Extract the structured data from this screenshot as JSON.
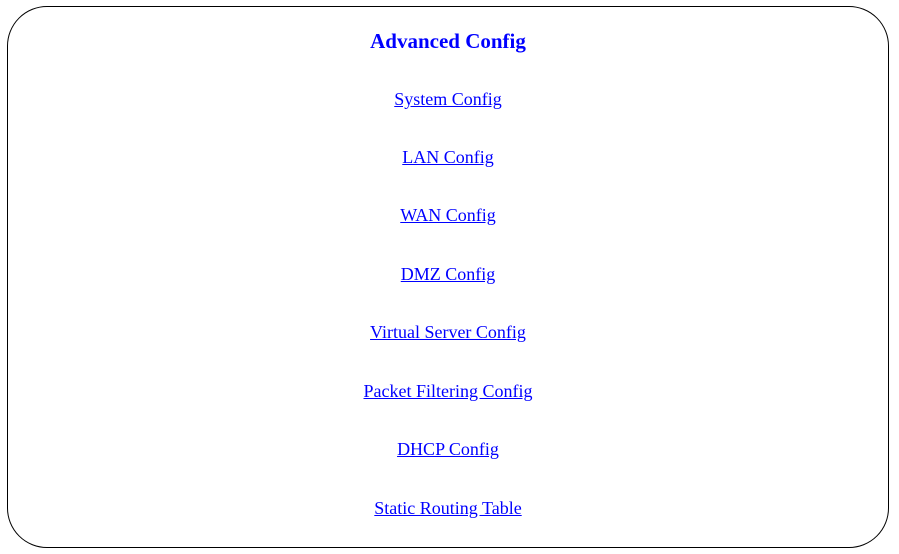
{
  "page": {
    "title": "Advanced Config"
  },
  "menu": {
    "items": [
      {
        "label": "System Config"
      },
      {
        "label": "LAN Config"
      },
      {
        "label": "WAN Config"
      },
      {
        "label": "DMZ Config"
      },
      {
        "label": "Virtual Server Config"
      },
      {
        "label": "Packet Filtering Config"
      },
      {
        "label": "DHCP Config"
      },
      {
        "label": "Static Routing Table"
      }
    ]
  },
  "colors": {
    "link": "#0000ff",
    "title": "#0000ff",
    "border": "#000000",
    "background": "#ffffff"
  }
}
